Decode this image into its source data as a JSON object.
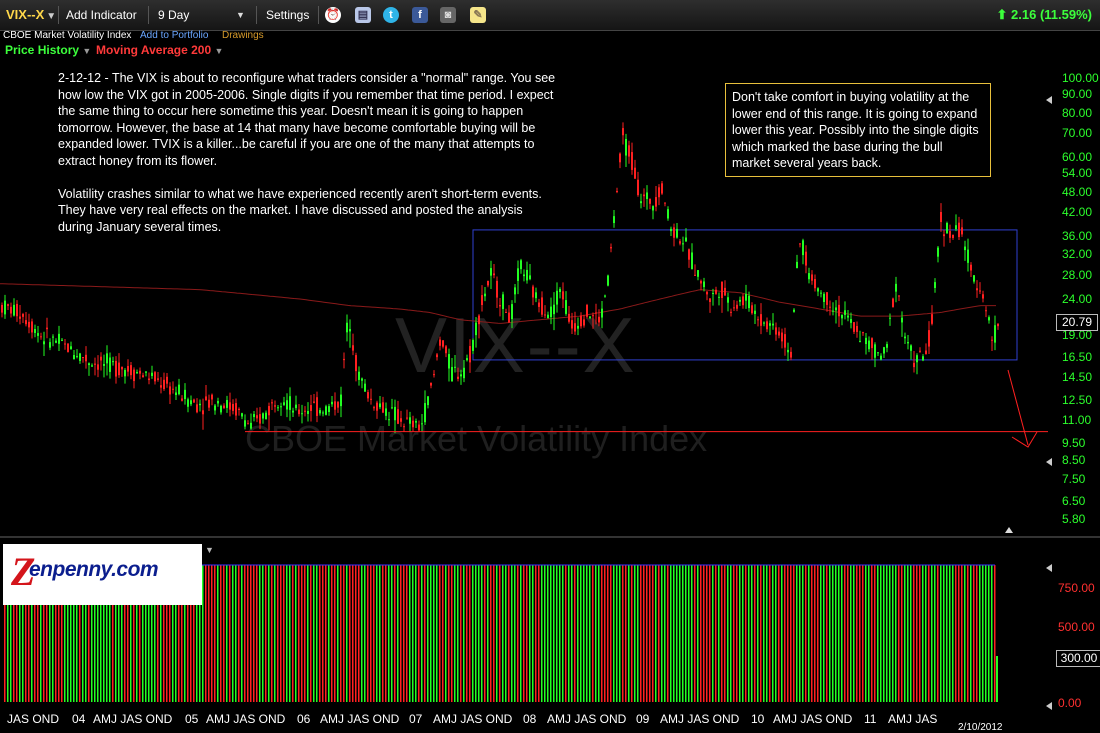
{
  "toolbar": {
    "ticker": "VIX--X",
    "add_indicator": "Add Indicator",
    "period": "9 Day",
    "settings": "Settings",
    "change": "2.16 (11.59%)"
  },
  "subbar": {
    "name": "CBOE Market Volatility Index",
    "add_to_portfolio": "Add to Portfolio",
    "drawings": "Drawings"
  },
  "legend": {
    "price_history": "Price History",
    "moving_average": "Moving Average 200"
  },
  "notes": {
    "left_p1": "2-12-12 - The VIX is about to reconfigure what traders consider a \"normal\" range. You see how low the VIX got in 2005-2006. Single digits if you remember that time period. I expect the same thing to occur here sometime this year. Doesn't mean it is going to happen tomorrow. However, the base at 14 that many have become comfortable buying will be expanded lower. TVIX is a killer...be careful if you are one of the many that attempts to extract honey from its flower.",
    "left_p2": "Volatility crashes similar to what we have experienced recently aren't short-term events. They have very real effects on the market. I have discussed and posted the analysis during January several times.",
    "right": "Don't take comfort in buying volatility at the lower end of this range. It is going to expand lower this year. Possibly into the single digits which marked the base during the bull market several years back."
  },
  "watermark": {
    "symbol": "VIX--X",
    "name": "CBOE Market Volatility Index"
  },
  "price_axis": [
    "100.00",
    "90.00",
    "80.00",
    "70.00",
    "60.00",
    "54.00",
    "48.00",
    "42.00",
    "36.00",
    "32.00",
    "28.00",
    "24.00",
    "19.00",
    "16.50",
    "14.50",
    "12.50",
    "11.00",
    "9.50",
    "8.50",
    "7.50",
    "6.50",
    "5.80"
  ],
  "current_price": "20.79",
  "volume_axis": [
    "750.00",
    "500.00",
    "0.00"
  ],
  "current_volume": "300.00",
  "x_axis": [
    {
      "label": "JAS OND"
    },
    {
      "label": "04"
    },
    {
      "label": "AMJ JAS OND"
    },
    {
      "label": "05"
    },
    {
      "label": "AMJ JAS OND"
    },
    {
      "label": "06"
    },
    {
      "label": "AMJ JAS OND"
    },
    {
      "label": "07"
    },
    {
      "label": "AMJ JAS OND"
    },
    {
      "label": "08"
    },
    {
      "label": "AMJ JAS OND"
    },
    {
      "label": "09"
    },
    {
      "label": "AMJ JAS OND"
    },
    {
      "label": "10"
    },
    {
      "label": "AMJ JAS OND"
    },
    {
      "label": "11"
    },
    {
      "label": "AMJ JAS"
    }
  ],
  "x_date": "2/10/2012",
  "logo": {
    "z": "Z",
    "text": "enpenny.com"
  },
  "colors": {
    "up": "#22ff22",
    "down": "#ff2020",
    "ma": "#8a1a1a",
    "box": "#3040d0",
    "support": "#ff2020",
    "accent": "#3cff3c"
  },
  "series": {
    "anchors": [
      [
        0,
        23
      ],
      [
        20,
        22
      ],
      [
        40,
        19
      ],
      [
        60,
        18
      ],
      [
        90,
        16
      ],
      [
        120,
        15.5
      ],
      [
        150,
        14.5
      ],
      [
        170,
        13.5
      ],
      [
        195,
        12.2
      ],
      [
        215,
        12.5
      ],
      [
        235,
        11.8
      ],
      [
        250,
        10.5
      ],
      [
        265,
        11.5
      ],
      [
        280,
        13
      ],
      [
        295,
        11.5
      ],
      [
        310,
        12
      ],
      [
        325,
        11.8
      ],
      [
        340,
        12.5
      ],
      [
        348,
        22
      ],
      [
        356,
        15
      ],
      [
        370,
        12.5
      ],
      [
        390,
        11.5
      ],
      [
        405,
        10.8
      ],
      [
        420,
        10.5
      ],
      [
        432,
        14
      ],
      [
        440,
        19
      ],
      [
        450,
        15
      ],
      [
        460,
        15
      ],
      [
        470,
        17
      ],
      [
        480,
        23
      ],
      [
        490,
        28
      ],
      [
        500,
        24
      ],
      [
        510,
        21
      ],
      [
        520,
        30
      ],
      [
        535,
        24
      ],
      [
        550,
        22
      ],
      [
        560,
        26
      ],
      [
        570,
        20
      ],
      [
        585,
        22
      ],
      [
        600,
        21
      ],
      [
        608,
        28
      ],
      [
        615,
        45
      ],
      [
        622,
        68
      ],
      [
        630,
        60
      ],
      [
        640,
        46
      ],
      [
        652,
        45
      ],
      [
        660,
        50
      ],
      [
        670,
        38
      ],
      [
        680,
        36
      ],
      [
        690,
        31
      ],
      [
        700,
        27
      ],
      [
        710,
        24
      ],
      [
        720,
        26
      ],
      [
        730,
        23
      ],
      [
        745,
        24
      ],
      [
        760,
        21
      ],
      [
        775,
        20
      ],
      [
        790,
        17
      ],
      [
        800,
        36
      ],
      [
        808,
        28
      ],
      [
        820,
        25
      ],
      [
        840,
        22
      ],
      [
        860,
        19
      ],
      [
        875,
        17
      ],
      [
        885,
        16.5
      ],
      [
        895,
        27
      ],
      [
        905,
        18
      ],
      [
        915,
        16
      ],
      [
        925,
        17
      ],
      [
        932,
        21
      ],
      [
        940,
        40
      ],
      [
        950,
        36
      ],
      [
        960,
        38
      ],
      [
        970,
        28
      ],
      [
        980,
        26
      ],
      [
        992,
        18
      ],
      [
        997,
        20.79
      ]
    ],
    "ma200": [
      [
        0,
        26.5
      ],
      [
        100,
        26
      ],
      [
        200,
        25.5
      ],
      [
        300,
        24
      ],
      [
        350,
        23
      ],
      [
        400,
        22.5
      ],
      [
        430,
        22
      ],
      [
        460,
        21
      ],
      [
        500,
        20.5
      ],
      [
        540,
        21
      ],
      [
        580,
        21.5
      ],
      [
        620,
        22.5
      ],
      [
        660,
        24
      ],
      [
        700,
        25.5
      ],
      [
        740,
        25
      ],
      [
        780,
        23.5
      ],
      [
        820,
        22.5
      ],
      [
        860,
        21.5
      ],
      [
        900,
        21.5
      ],
      [
        940,
        22
      ],
      [
        980,
        23
      ],
      [
        997,
        23
      ]
    ],
    "box": {
      "low": 16.2,
      "high": 37.5,
      "start": 473,
      "end": 1017
    },
    "support": 10.2
  }
}
